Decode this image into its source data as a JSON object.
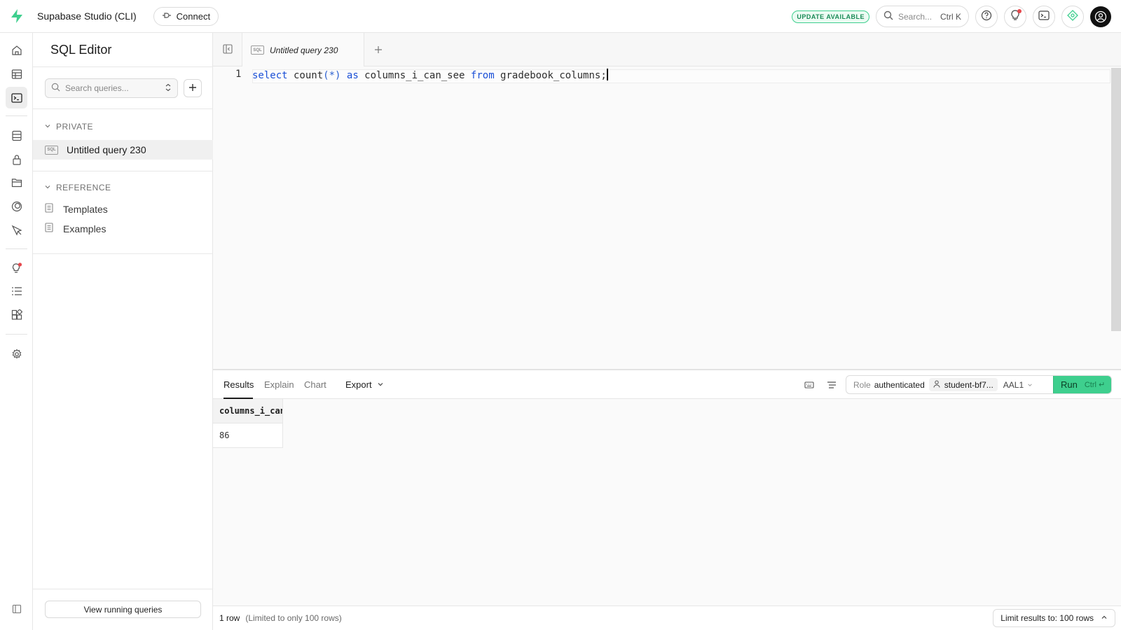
{
  "topbar": {
    "brand": "Supabase Studio (CLI)",
    "connect_label": "Connect",
    "update_badge": "UPDATE AVAILABLE",
    "search_placeholder": "Search...",
    "search_shortcut": "Ctrl K",
    "accent": "#3ecf8e"
  },
  "sidebar": {
    "title": "SQL Editor",
    "search_placeholder": "Search queries...",
    "private_header": "PRIVATE",
    "private_items": [
      {
        "chip": "SQL",
        "label": "Untitled query 230"
      }
    ],
    "reference_header": "REFERENCE",
    "reference_items": [
      {
        "label": "Templates"
      },
      {
        "label": "Examples"
      }
    ],
    "view_running_label": "View running queries"
  },
  "editor": {
    "tab_label": "Untitled query 230",
    "line_number": "1",
    "code_tokens": [
      {
        "t": "select",
        "k": "kw"
      },
      {
        "t": " count",
        "k": "plain"
      },
      {
        "t": "(*)",
        "k": "paren"
      },
      {
        "t": " ",
        "k": "plain"
      },
      {
        "t": "as",
        "k": "kw"
      },
      {
        "t": " columns_i_can_see ",
        "k": "plain"
      },
      {
        "t": "from",
        "k": "kw"
      },
      {
        "t": " gradebook_columns;",
        "k": "plain"
      }
    ]
  },
  "results": {
    "tabs": [
      "Results",
      "Explain",
      "Chart"
    ],
    "export_label": "Export",
    "role_label": "Role",
    "role_value": "authenticated",
    "user": "student-bf7...",
    "aal": "AAL1",
    "run_label": "Run",
    "run_shortcut": "Ctrl ↵",
    "column_header": "columns_i_can",
    "cell_value": "86",
    "row_count": "1 row",
    "limited_text": "(Limited to only 100 rows)",
    "limit_label": "Limit results to: 100 rows"
  },
  "icons": {
    "rail": [
      "home-icon",
      "table-editor-icon",
      "sql-editor-icon",
      "database-icon",
      "auth-icon",
      "storage-icon",
      "realtime-icon",
      "edge-functions-icon",
      "advisors-icon",
      "logs-icon",
      "integrations-icon",
      "settings-icon",
      "collapse-sidebar-icon"
    ]
  }
}
